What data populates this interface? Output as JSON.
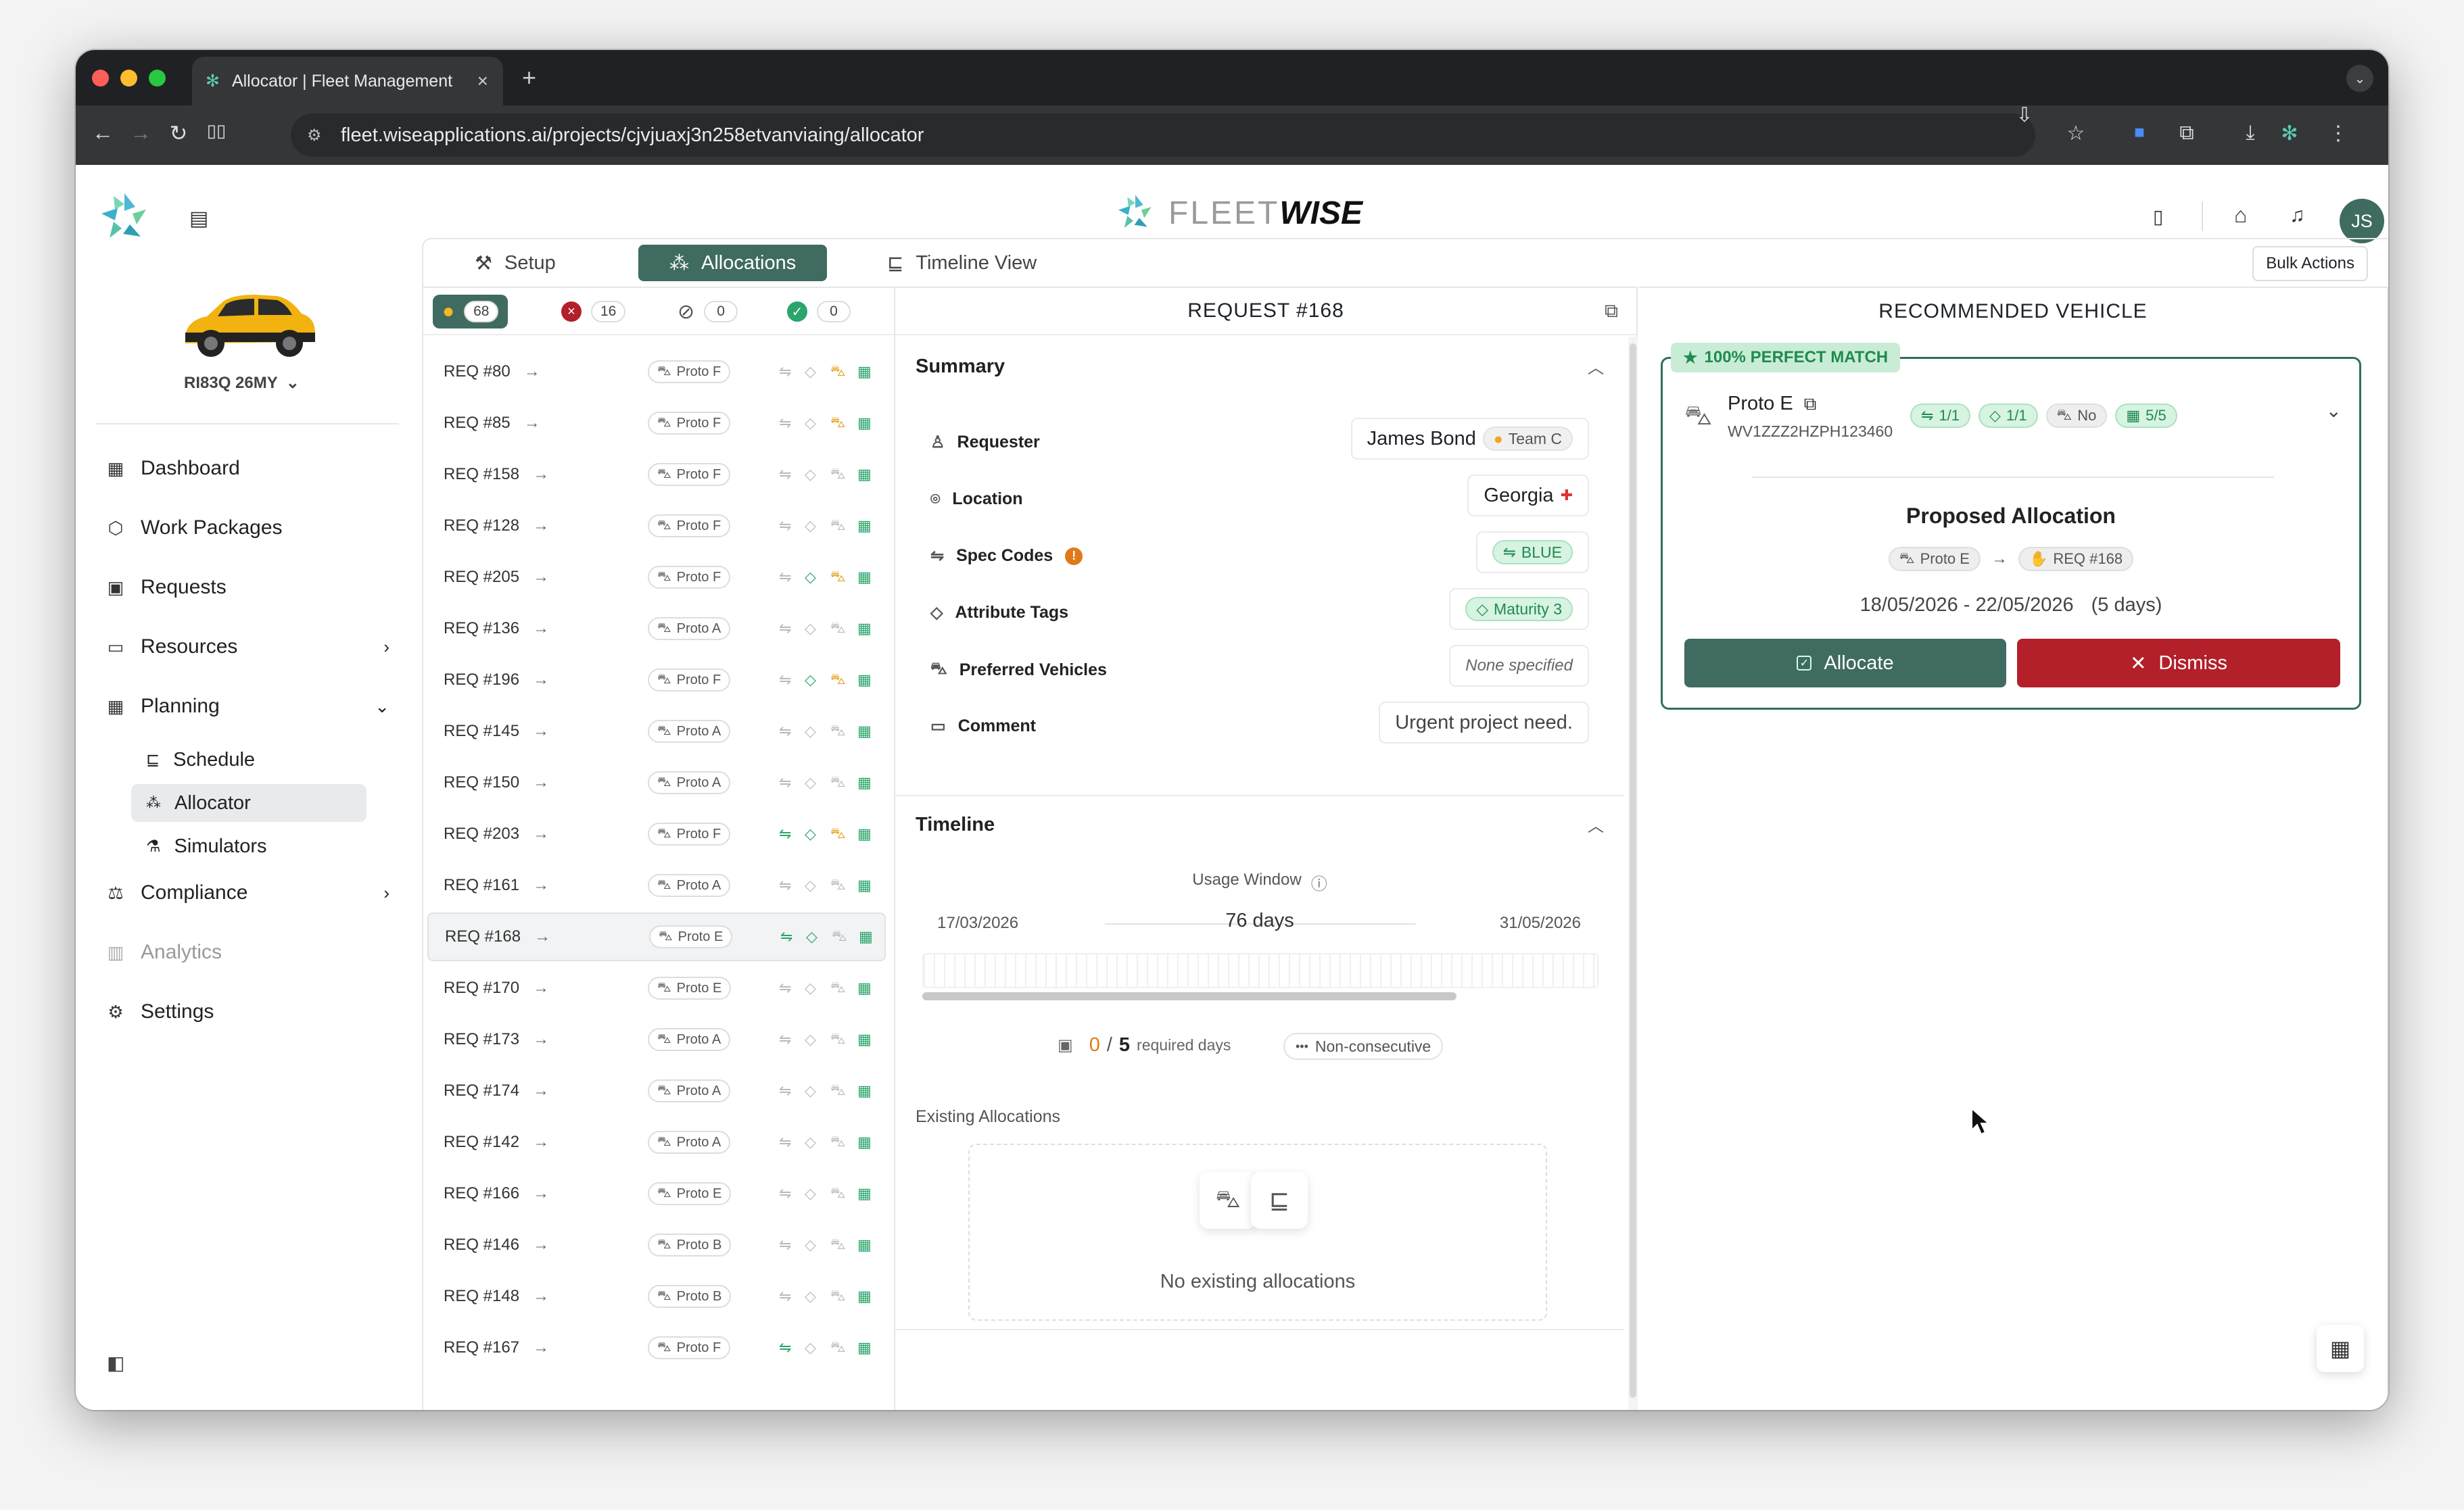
{
  "browser": {
    "tab_title": "Allocator | Fleet Management",
    "url": "fleet.wiseapplications.ai/projects/cjvjuaxj3n258etvanviaing/allocator"
  },
  "brand": {
    "word_light": "FLEET",
    "word_bold": "WISE"
  },
  "user": {
    "initials": "JS"
  },
  "vehicle_selector": {
    "label": "RI83Q 26MY"
  },
  "sidebar": {
    "items": [
      {
        "label": "Dashboard"
      },
      {
        "label": "Work Packages"
      },
      {
        "label": "Requests"
      },
      {
        "label": "Resources"
      },
      {
        "label": "Planning"
      },
      {
        "label": "Compliance"
      },
      {
        "label": "Analytics"
      },
      {
        "label": "Settings"
      }
    ],
    "planning_sub": [
      {
        "label": "Schedule"
      },
      {
        "label": "Allocator"
      },
      {
        "label": "Simulators"
      }
    ]
  },
  "tabs": [
    "Setup",
    "Allocations",
    "Timeline View"
  ],
  "bulk_actions": "Bulk Actions",
  "filters": {
    "pending": "68",
    "errors": "16",
    "blocked": "0",
    "done": "0"
  },
  "requests": [
    {
      "id": "REQ #80",
      "proto": "Proto F",
      "spec": "grey",
      "tag": "grey",
      "veh": "yellow"
    },
    {
      "id": "REQ #85",
      "proto": "Proto F",
      "spec": "grey",
      "tag": "grey",
      "veh": "yellow"
    },
    {
      "id": "REQ #158",
      "proto": "Proto F",
      "spec": "grey",
      "tag": "grey",
      "veh": "grey"
    },
    {
      "id": "REQ #128",
      "proto": "Proto F",
      "spec": "grey",
      "tag": "grey",
      "veh": "grey"
    },
    {
      "id": "REQ #205",
      "proto": "Proto F",
      "spec": "grey",
      "tag": "green",
      "veh": "yellow"
    },
    {
      "id": "REQ #136",
      "proto": "Proto A",
      "spec": "grey",
      "tag": "grey",
      "veh": "grey"
    },
    {
      "id": "REQ #196",
      "proto": "Proto F",
      "spec": "grey",
      "tag": "green",
      "veh": "yellow"
    },
    {
      "id": "REQ #145",
      "proto": "Proto A",
      "spec": "grey",
      "tag": "grey",
      "veh": "grey"
    },
    {
      "id": "REQ #150",
      "proto": "Proto A",
      "spec": "grey",
      "tag": "grey",
      "veh": "grey"
    },
    {
      "id": "REQ #203",
      "proto": "Proto F",
      "spec": "green",
      "tag": "green",
      "veh": "yellow"
    },
    {
      "id": "REQ #161",
      "proto": "Proto A",
      "spec": "grey",
      "tag": "grey",
      "veh": "grey"
    },
    {
      "id": "REQ #168",
      "proto": "Proto E",
      "spec": "green",
      "tag": "green",
      "veh": "grey"
    },
    {
      "id": "REQ #170",
      "proto": "Proto E",
      "spec": "grey",
      "tag": "grey",
      "veh": "grey"
    },
    {
      "id": "REQ #173",
      "proto": "Proto A",
      "spec": "grey",
      "tag": "grey",
      "veh": "grey"
    },
    {
      "id": "REQ #174",
      "proto": "Proto A",
      "spec": "grey",
      "tag": "grey",
      "veh": "grey"
    },
    {
      "id": "REQ #142",
      "proto": "Proto A",
      "spec": "grey",
      "tag": "grey",
      "veh": "grey"
    },
    {
      "id": "REQ #166",
      "proto": "Proto E",
      "spec": "grey",
      "tag": "grey",
      "veh": "grey"
    },
    {
      "id": "REQ #146",
      "proto": "Proto B",
      "spec": "grey",
      "tag": "grey",
      "veh": "grey"
    },
    {
      "id": "REQ #148",
      "proto": "Proto B",
      "spec": "grey",
      "tag": "grey",
      "veh": "grey"
    },
    {
      "id": "REQ #167",
      "proto": "Proto F",
      "spec": "green",
      "tag": "grey",
      "veh": "grey"
    }
  ],
  "request": {
    "title": "REQUEST #168",
    "summary_title": "Summary",
    "fields": {
      "requester_label": "Requester",
      "requester": "James Bond",
      "team": "Team C",
      "location_label": "Location",
      "location": "Georgia",
      "spec_label": "Spec Codes",
      "spec": "BLUE",
      "tags_label": "Attribute Tags",
      "tag": "Maturity 3",
      "pref_label": "Preferred Vehicles",
      "pref": "None specified",
      "comment_label": "Comment",
      "comment": "Urgent project need."
    },
    "timeline_title": "Timeline",
    "usage_window": "Usage Window",
    "start": "17/03/2026",
    "days": "76 days",
    "end": "31/05/2026",
    "required_done": "0",
    "required_total": "5",
    "required_label": "required days",
    "consec": "Non-consecutive",
    "existing_title": "Existing Allocations",
    "existing_empty": "No existing allocations"
  },
  "recommended": {
    "title": "RECOMMENDED VEHICLE",
    "match": "100% PERFECT MATCH",
    "vehicle": "Proto E",
    "vin": "WV1ZZZ2HZPH123460",
    "stats": {
      "spec": "1/1",
      "tag": "1/1",
      "veh": "No",
      "days": "5/5"
    },
    "proposed_title": "Proposed Allocation",
    "from": "Proto E",
    "to": "REQ #168",
    "dates": "18/05/2026 - 22/05/2026",
    "duration": "(5 days)",
    "allocate": "Allocate",
    "dismiss": "Dismiss"
  },
  "colors": {
    "accent": "#3f6b60",
    "danger": "#b3202a",
    "match": "#c9ecd6"
  }
}
